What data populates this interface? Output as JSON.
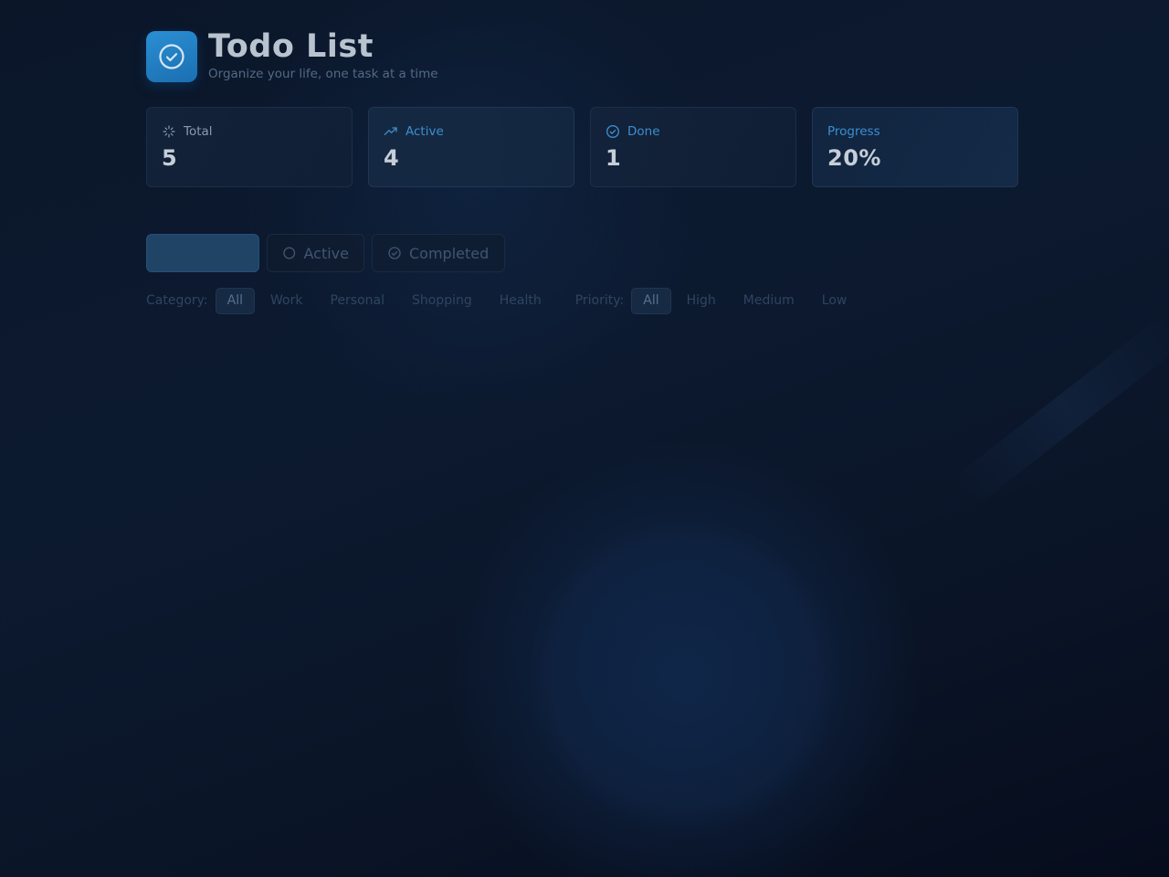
{
  "header": {
    "title": "Todo List",
    "subtitle": "Organize your life, one task at a time",
    "logo_icon": "check-circle-icon"
  },
  "stats": [
    {
      "label": "Total",
      "value": "5",
      "icon": "sparkles-icon"
    },
    {
      "label": "Active",
      "value": "4",
      "icon": "trending-up-icon"
    },
    {
      "label": "Done",
      "value": "1",
      "icon": "check-circle-icon"
    },
    {
      "label": "Progress",
      "value": "20%"
    }
  ],
  "tabs": {
    "all_label": "",
    "active_label": "Active",
    "completed_label": "Completed"
  },
  "filters": {
    "category_label": "Category:",
    "categories": [
      "All",
      "Work",
      "Personal",
      "Shopping",
      "Health"
    ],
    "selected_category": "All",
    "priority_label": "Priority:",
    "priorities": [
      "All",
      "High",
      "Medium",
      "Low"
    ],
    "selected_priority": "All"
  },
  "colors": {
    "accent": "#2b8fd4",
    "background": "#0b1629",
    "accent_text": "#3b8fd0"
  }
}
